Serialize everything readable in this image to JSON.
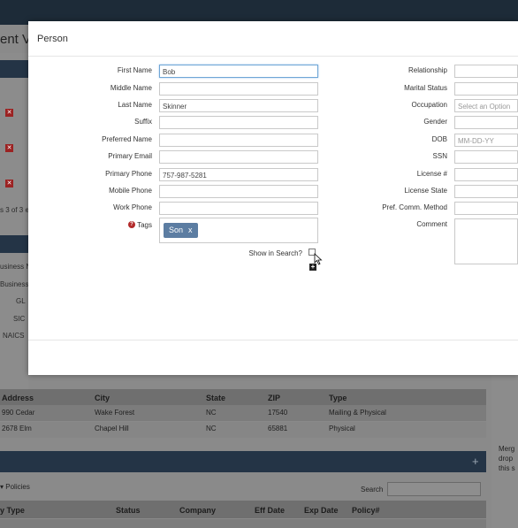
{
  "modal": {
    "title": "Person",
    "left_fields": [
      {
        "label": "First Name",
        "value": "Bob"
      },
      {
        "label": "Middle Name",
        "value": ""
      },
      {
        "label": "Last Name",
        "value": "Skinner"
      },
      {
        "label": "Suffix",
        "value": ""
      },
      {
        "label": "Preferred Name",
        "value": ""
      },
      {
        "label": "Primary Email",
        "value": ""
      },
      {
        "label": "Primary Phone",
        "value": "757-987-5281"
      },
      {
        "label": "Mobile Phone",
        "value": ""
      },
      {
        "label": "Work Phone",
        "value": ""
      }
    ],
    "tags_label": "Tags",
    "tags": [
      {
        "label": "Son",
        "remove": "x"
      }
    ],
    "show_in_search_label": "Show in Search?",
    "right_fields": [
      {
        "label": "Relationship",
        "value": ""
      },
      {
        "label": "Marital Status",
        "value": ""
      },
      {
        "label": "Occupation",
        "placeholder": "Select an Option"
      },
      {
        "label": "Gender",
        "value": ""
      },
      {
        "label": "DOB",
        "placeholder": "MM-DD-YY"
      },
      {
        "label": "SSN",
        "value": ""
      },
      {
        "label": "License #",
        "value": ""
      },
      {
        "label": "License State",
        "value": ""
      },
      {
        "label": "Pref. Comm. Method",
        "value": ""
      }
    ],
    "comment_label": "Comment"
  },
  "background": {
    "page_title": "ent V",
    "left_snippets": [
      "s 3 of 3 e",
      "usiness N",
      "Business",
      "GL",
      "SIC",
      "NAICS"
    ],
    "address_table": {
      "headers": [
        "Address",
        "City",
        "State",
        "ZIP",
        "Type"
      ],
      "rows": [
        [
          "990 Cedar",
          "Wake Forest",
          "NC",
          "17540",
          "Mailing & Physical"
        ],
        [
          "2678 Elm",
          "Chapel Hill",
          "NC",
          "65881",
          "Physical"
        ]
      ]
    },
    "policies_label": "Policies",
    "search_label": "Search",
    "policy_table": {
      "headers": [
        "y Type",
        "Status",
        "Company",
        "Eff Date",
        "Exp Date",
        "Policy#"
      ]
    },
    "merge_text": [
      "Merg",
      "drop",
      "this s"
    ]
  },
  "colors": {
    "tag_bg": "#5c7da2",
    "help_icon": "#b32b2b",
    "focus_border": "#6fa6d6",
    "dark_bar": "#243446"
  }
}
